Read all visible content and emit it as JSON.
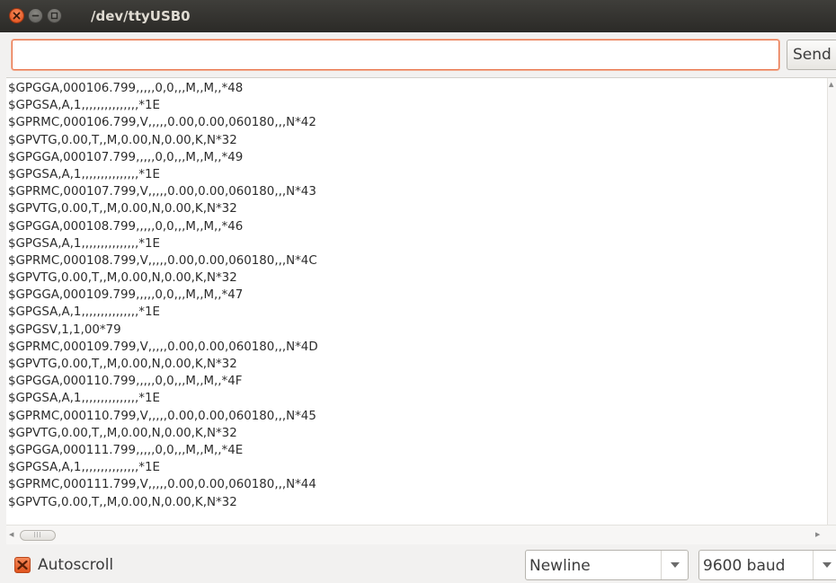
{
  "window": {
    "title": "/dev/ttyUSB0",
    "controls": {
      "close_icon": "close-icon",
      "minimize_icon": "minimize-icon",
      "maximize_icon": "maximize-icon"
    }
  },
  "input_bar": {
    "value": "",
    "send_label": "Send"
  },
  "output": {
    "lines": [
      "$GPGGA,000106.799,,,,,0,0,,,M,,M,,*48",
      "$GPGSA,A,1,,,,,,,,,,,,,,,*1E",
      "$GPRMC,000106.799,V,,,,,0.00,0.00,060180,,,N*42",
      "$GPVTG,0.00,T,,M,0.00,N,0.00,K,N*32",
      "$GPGGA,000107.799,,,,,0,0,,,M,,M,,*49",
      "$GPGSA,A,1,,,,,,,,,,,,,,,*1E",
      "$GPRMC,000107.799,V,,,,,0.00,0.00,060180,,,N*43",
      "$GPVTG,0.00,T,,M,0.00,N,0.00,K,N*32",
      "$GPGGA,000108.799,,,,,0,0,,,M,,M,,*46",
      "$GPGSA,A,1,,,,,,,,,,,,,,,*1E",
      "$GPRMC,000108.799,V,,,,,0.00,0.00,060180,,,N*4C",
      "$GPVTG,0.00,T,,M,0.00,N,0.00,K,N*32",
      "$GPGGA,000109.799,,,,,0,0,,,M,,M,,*47",
      "$GPGSA,A,1,,,,,,,,,,,,,,,*1E",
      "$GPGSV,1,1,00*79",
      "$GPRMC,000109.799,V,,,,,0.00,0.00,060180,,,N*4D",
      "$GPVTG,0.00,T,,M,0.00,N,0.00,K,N*32",
      "$GPGGA,000110.799,,,,,0,0,,,M,,M,,*4F",
      "$GPGSA,A,1,,,,,,,,,,,,,,,*1E",
      "$GPRMC,000110.799,V,,,,,0.00,0.00,060180,,,N*45",
      "$GPVTG,0.00,T,,M,0.00,N,0.00,K,N*32",
      "$GPGGA,000111.799,,,,,0,0,,,M,,M,,*4E",
      "$GPGSA,A,1,,,,,,,,,,,,,,,*1E",
      "$GPRMC,000111.799,V,,,,,0.00,0.00,060180,,,N*44",
      "$GPVTG,0.00,T,,M,0.00,N,0.00,K,N*32"
    ]
  },
  "footer": {
    "autoscroll_label": "Autoscroll",
    "autoscroll_checked": true,
    "line_ending": "Newline",
    "baud_rate": "9600 baud"
  },
  "colors": {
    "accent": "#e0541e",
    "titlebar": "#3c3b37",
    "input_focus_border": "#e9744a"
  }
}
